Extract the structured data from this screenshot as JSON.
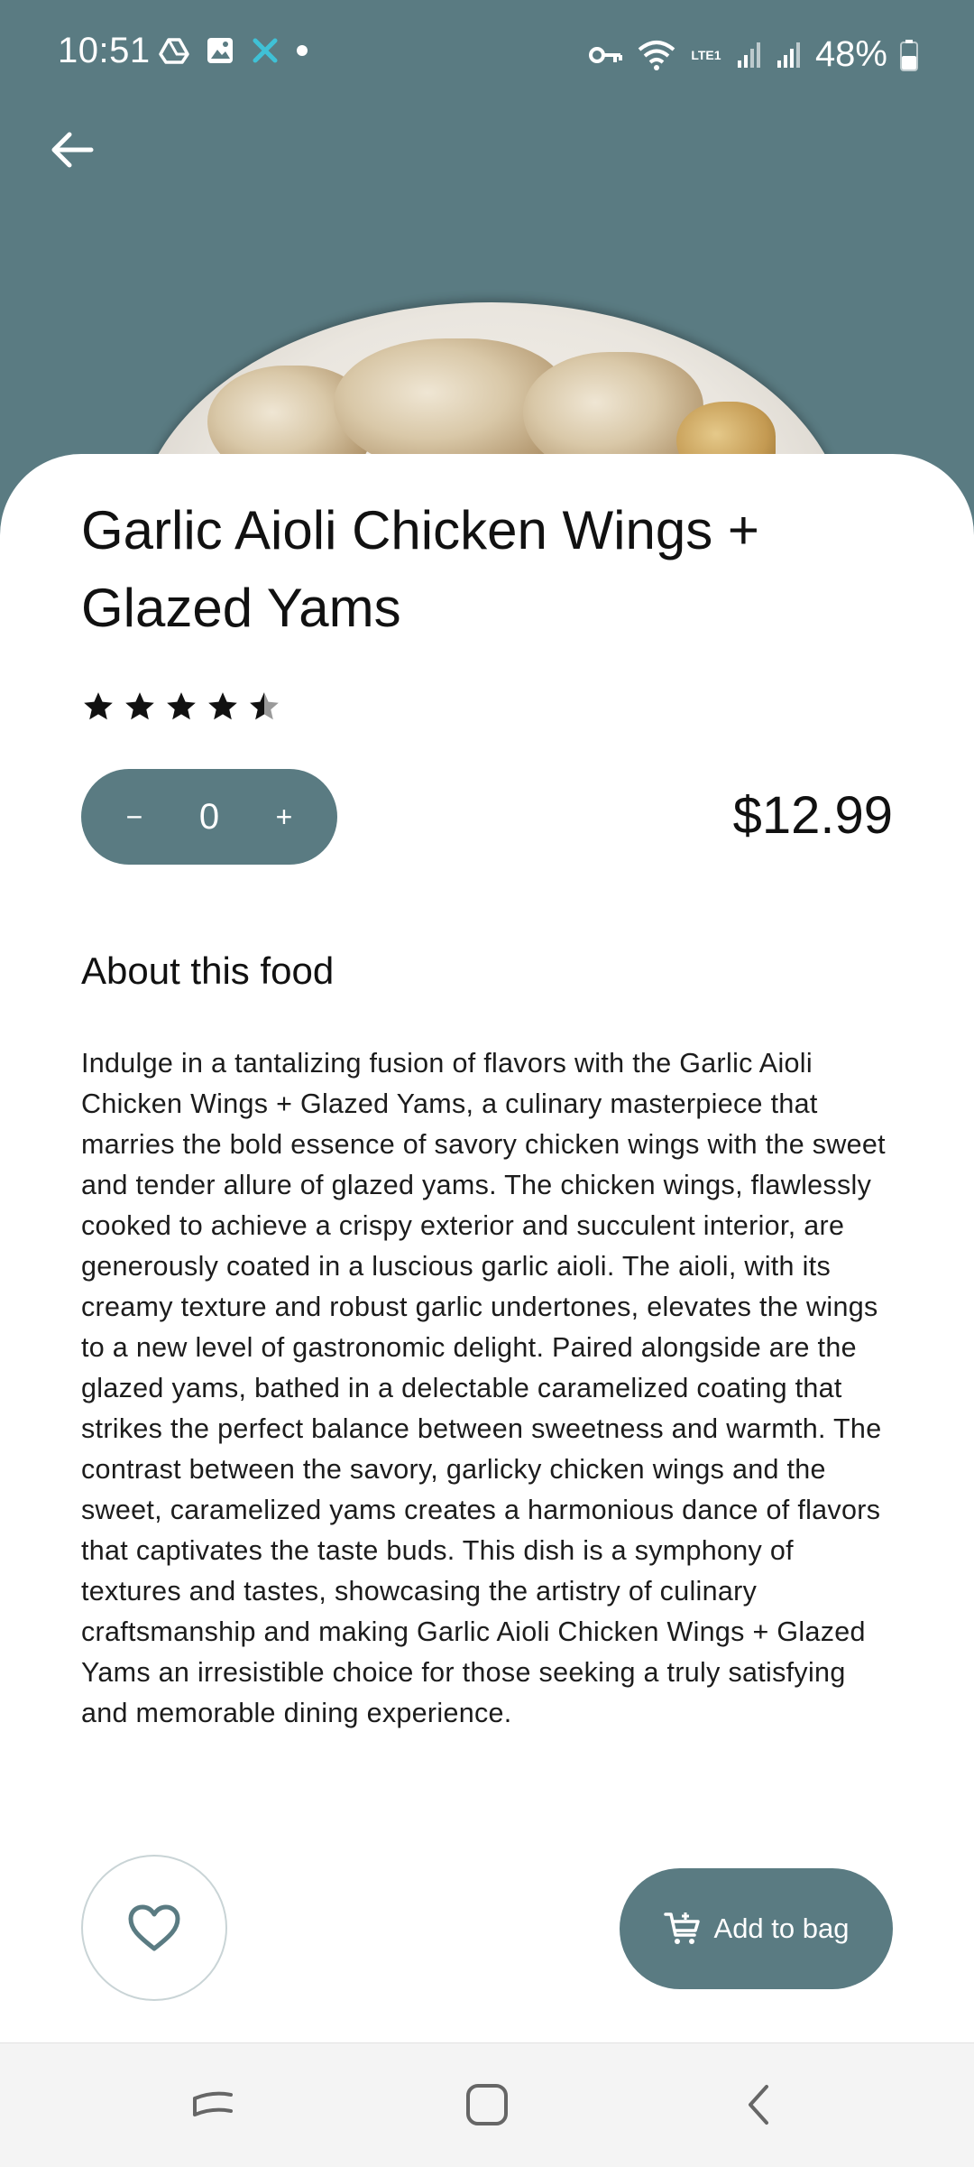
{
  "status_bar": {
    "time": "10:51",
    "battery": "48%",
    "network_label": "LTE1"
  },
  "header": {
    "back_icon": "arrow-left-icon",
    "hero_color": "#5a7b82"
  },
  "product": {
    "name": "Garlic Aioli Chicken Wings + Glazed Yams",
    "rating": 4.5,
    "rating_max": 5,
    "quantity": "0",
    "decrement_label": "−",
    "increment_label": "+",
    "price": "$12.99"
  },
  "about": {
    "heading": "About this food",
    "description": "Indulge in a tantalizing fusion of flavors with the Garlic Aioli Chicken Wings + Glazed Yams, a culinary masterpiece that marries the bold essence of savory chicken wings with the sweet and tender allure of glazed yams. The chicken wings, flawlessly cooked to achieve a crispy exterior and succulent interior, are generously coated in a luscious garlic aioli. The aioli, with its creamy texture and robust garlic undertones, elevates the wings to a new level of gastronomic delight. Paired alongside are the glazed yams, bathed in a delectable caramelized coating that strikes the perfect balance between sweetness and warmth. The contrast between the savory, garlicky chicken wings and the sweet, caramelized yams creates a harmonious dance of flavors that captivates the taste buds. This dish is a symphony of textures and tastes, showcasing the artistry of culinary craftsmanship and making Garlic Aioli Chicken Wings + Glazed Yams an irresistible choice for those seeking a truly satisfying and memorable dining experience."
  },
  "actions": {
    "favorite_icon": "heart-icon",
    "add_to_bag_label": "Add to bag",
    "add_to_bag_icon": "cart-plus-icon"
  },
  "nav": {
    "recents_icon": "recents-icon",
    "home_icon": "home-icon",
    "back_icon": "back-chevron-icon"
  },
  "colors": {
    "accent": "#5a7b82",
    "text": "#111111",
    "nav_bg": "#f4f4f4"
  }
}
